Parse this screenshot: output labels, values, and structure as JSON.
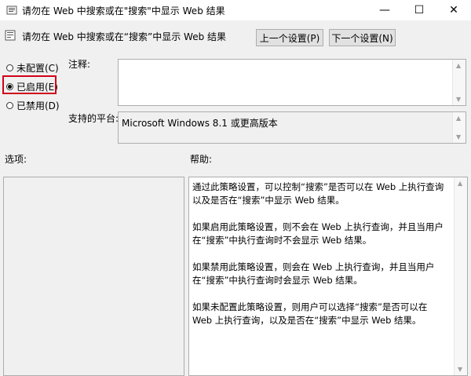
{
  "window": {
    "title": "请勿在 Web 中搜索或在\"搜索\"中显示 Web 结果"
  },
  "header": {
    "title": "请勿在 Web 中搜索或在“搜索”中显示 Web 结果"
  },
  "nav": {
    "prev_label": "上一个设置(P)",
    "next_label": "下一个设置(N)"
  },
  "options": [
    {
      "label": "未配置(C)",
      "selected": false
    },
    {
      "label": "已启用(E)",
      "selected": true
    },
    {
      "label": "已禁用(D)",
      "selected": false
    }
  ],
  "comment": {
    "label": "注释:",
    "value": ""
  },
  "platform": {
    "label": "支持的平台:",
    "value": "Microsoft Windows 8.1 或更高版本"
  },
  "options_section": {
    "label": "选项:"
  },
  "help": {
    "label": "帮助:",
    "paragraphs": [
      "通过此策略设置，可以控制“搜索”是否可以在 Web 上执行查询以及是否在“搜索”中显示 Web 结果。",
      "如果启用此策略设置，则不会在 Web 上执行查询，并且当用户在“搜索”中执行查询时不会显示 Web 结果。",
      "如果禁用此策略设置，则会在 Web 上执行查询，并且当用户在“搜索”中执行查询时会显示 Web 结果。",
      "如果未配置此策略设置，则用户可以选择“搜索”是否可以在 Web 上执行查询，以及是否在“搜索”中显示 Web 结果。"
    ]
  },
  "colors": {
    "highlight": "#d0021b",
    "window_bg": "#f0f0f0"
  }
}
